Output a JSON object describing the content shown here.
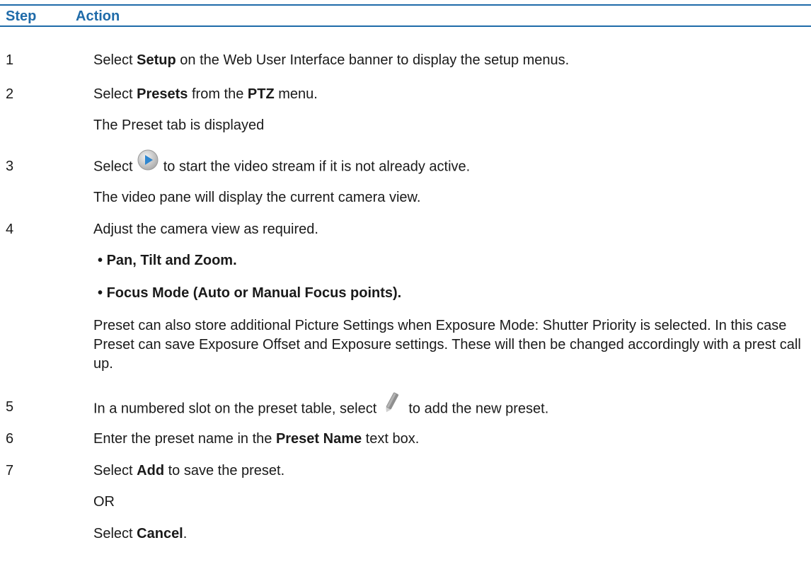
{
  "header": {
    "step": "Step",
    "action": "Action"
  },
  "rows": {
    "s1": {
      "num": "1",
      "a": "Select ",
      "b": "Setup",
      "c": " on the Web User Interface banner to display the setup menus."
    },
    "s2": {
      "num": "2",
      "a": "Select ",
      "b": "Presets",
      "c": " from the ",
      "d": "PTZ",
      "e": " menu.",
      "result": "The Preset tab is displayed"
    },
    "s3": {
      "num": "3",
      "a": "Select ",
      "icon": "play-icon",
      "c": " to start the video stream if it is not already active.",
      "result": "The video pane will display the current camera view."
    },
    "s4": {
      "num": "4",
      "a": "Adjust the camera view as required.",
      "bullet1": "Pan, Tilt and Zoom.",
      "bullet2": "Focus Mode (Auto or Manual Focus points).",
      "note": "Preset can also store additional Picture Settings when Exposure Mode: Shutter Priority is selected. In this case Preset can save Exposure Offset and Exposure settings. These will then be changed accordingly with a prest call up."
    },
    "s5": {
      "num": "5",
      "a": "In a numbered slot on the preset table, select ",
      "icon": "pencil-icon",
      "c": " to add the new preset."
    },
    "s6": {
      "num": "6",
      "a": "Enter the preset name in the ",
      "b": "Preset Name",
      "c": " text box."
    },
    "s7": {
      "num": "7",
      "a": "Select ",
      "b": "Add",
      "c": " to save the preset.",
      "or": "OR",
      "d": "Select ",
      "e": "Cancel",
      "f": "."
    }
  },
  "colors": {
    "accent": "#1f6ba9",
    "text": "#1a1a1a"
  }
}
